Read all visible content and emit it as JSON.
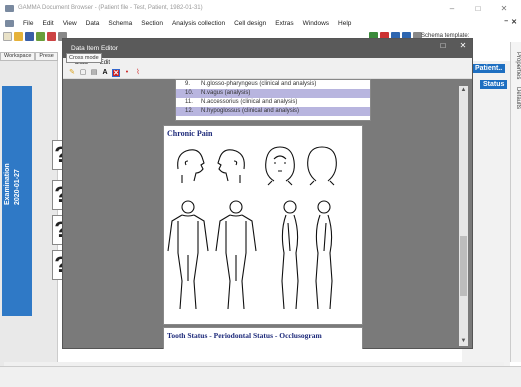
{
  "app": {
    "title": "GAMMA Document Browser - (Patient file - Test, Patient, 1982-01-31)",
    "window_controls": [
      "–",
      "□",
      "✕"
    ]
  },
  "menubar": {
    "items": [
      "File",
      "Edit",
      "View",
      "Data",
      "Schema",
      "Section",
      "Analysis collection",
      "Cell design",
      "Extras",
      "Windows",
      "Help"
    ],
    "right_controls": [
      "–",
      "✕"
    ]
  },
  "toolbar": {
    "schema_label": "Schema template:"
  },
  "workspace": {
    "tabs": [
      "Workspace",
      "Prese"
    ]
  },
  "left_pane": {
    "exam_title": "Examination",
    "exam_date": "2020-01-27",
    "cards": [
      "?",
      "?",
      "?",
      "?"
    ]
  },
  "right_pane": {
    "tab_patient": "Patient..",
    "tab_status": "Status",
    "side_tabs": [
      "Properties",
      "Defaults"
    ]
  },
  "dialog": {
    "title": "Data Item Editor",
    "controls": [
      "□",
      "✕"
    ],
    "menu": [
      "Data",
      "Edit"
    ],
    "tooltip": "Cross mode",
    "nerve_list": [
      {
        "num": "9.",
        "label": "N.glosso-pharyngeus (clinical and analysis)",
        "selected": false
      },
      {
        "num": "10.",
        "label": "N.vagus (analysis)",
        "selected": true
      },
      {
        "num": "11.",
        "label": "N.accessorius (clinical and analysis)",
        "selected": false
      },
      {
        "num": "12.",
        "label": "N.hypoglossus (clinical and analysis)",
        "selected": true
      }
    ],
    "pain_title": "Chronic Pain",
    "tooth_title": "Tooth Status - Periodontal Status - Occlusogram"
  },
  "colors": {
    "accent": "#1e6fc1",
    "selection": "#b8b5df",
    "dialog_bg": "#7a7a7a",
    "panel_title": "#1d2a7a"
  }
}
